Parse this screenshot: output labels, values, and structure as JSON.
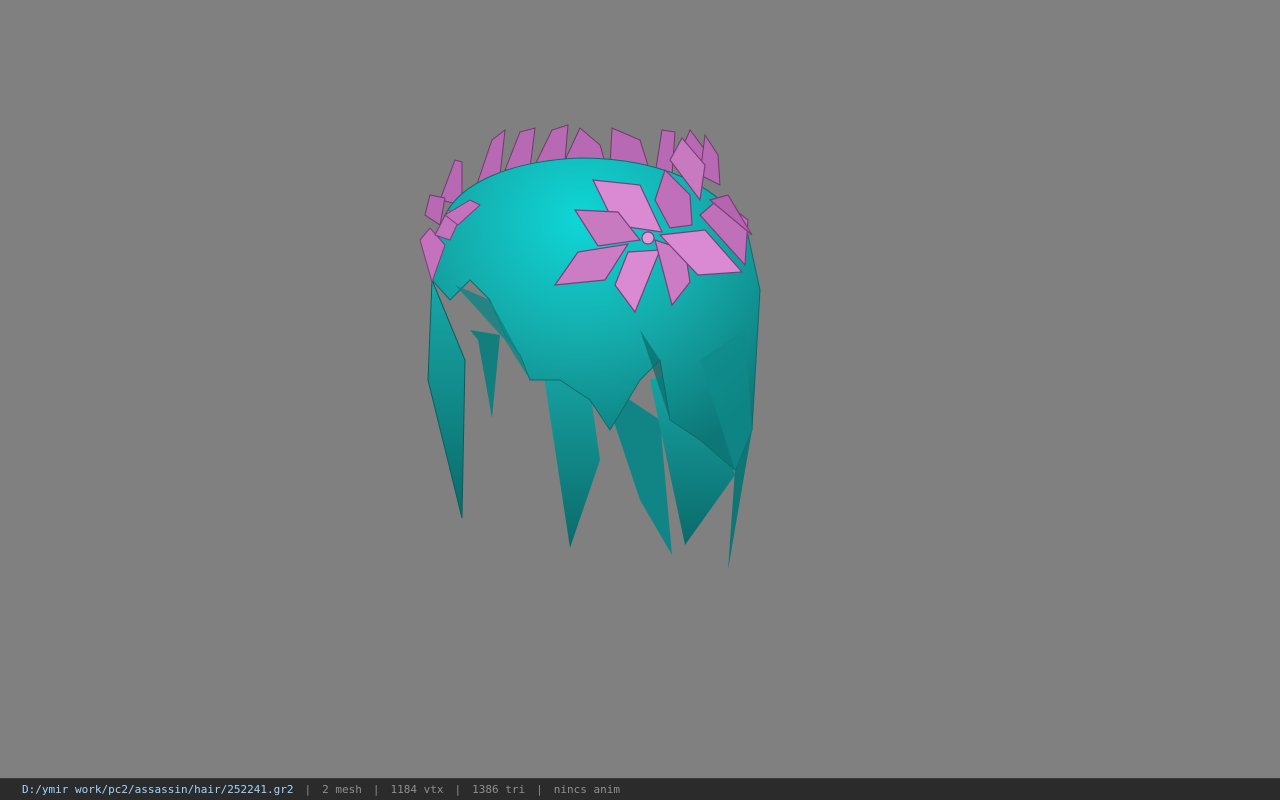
{
  "viewport": {
    "background": "#808080",
    "model": {
      "hair_color": "#17a5a5",
      "hair_highlight": "#0fd0d0",
      "flower_color": "#d77fd0",
      "flower_shadow": "#a2559a"
    }
  },
  "status_bar": {
    "file_path": "D:/ymir work/pc2/assassin/hair/252241.gr2",
    "separator": "|",
    "mesh_count": "2 mesh",
    "vertex_count": "1184 vtx",
    "triangle_count": "1386 tri",
    "anim_status": "nincs anim"
  }
}
